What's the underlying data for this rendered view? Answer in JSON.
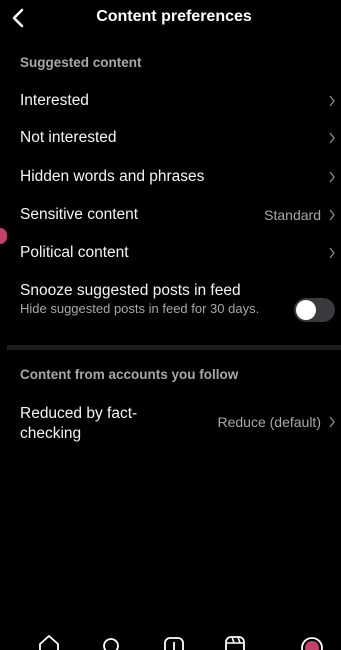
{
  "header": {
    "title": "Content preferences"
  },
  "sections": {
    "suggested_label": "Suggested content",
    "following_label": "Content from accounts you follow"
  },
  "rows": [
    {
      "label": "Interested",
      "value": ""
    },
    {
      "label": "Not interested",
      "value": ""
    },
    {
      "label": "Hidden words and phrases",
      "value": ""
    },
    {
      "label": "Sensitive content",
      "value": "Standard"
    },
    {
      "label": "Political content",
      "value": ""
    }
  ],
  "snooze": {
    "title": "Snooze suggested posts in feed",
    "subtitle": "Hide suggested posts in feed for 30 days.",
    "enabled": false
  },
  "reduced": {
    "label": "Reduced by fact-checking",
    "value": "Reduce (default)"
  },
  "tabbar": {
    "icons": [
      "home-icon",
      "search-icon",
      "create-icon",
      "reels-icon",
      "profile-icon"
    ]
  },
  "colors": {
    "background": "#000000",
    "text": "#f5f5f5",
    "secondary_text": "#a8a8a8",
    "toggle_off": "#3a3a3c"
  }
}
